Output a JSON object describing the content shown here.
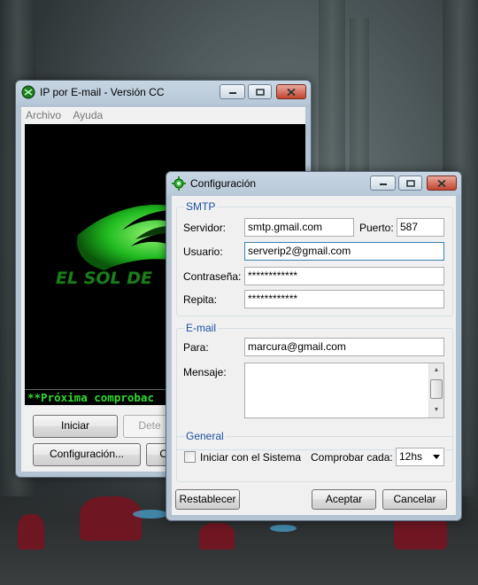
{
  "main_window": {
    "title": "IP por E-mail - Versión CC",
    "menu": [
      "Archivo",
      "Ayuda"
    ],
    "logo_text": "EL SOL DE",
    "status_text": "**Próxima comprobac",
    "buttons": {
      "start": "Iniciar",
      "stop": "Dete",
      "config": "Configuración...",
      "partial": "O"
    }
  },
  "config_dialog": {
    "title": "Configuración",
    "smtp": {
      "group_label": "SMTP",
      "server_label": "Servidor:",
      "server_value": "smtp.gmail.com",
      "port_label": "Puerto:",
      "port_value": "587",
      "user_label": "Usuario:",
      "user_value": "serverip2@gmail.com",
      "password_label": "Contraseña:",
      "password_value": "************",
      "repeat_label": "Repita:",
      "repeat_value": "************"
    },
    "email": {
      "group_label": "E-mail",
      "to_label": "Para:",
      "to_value": "marcura@gmail.com",
      "message_label": "Mensaje:",
      "message_value": ""
    },
    "general": {
      "group_label": "General",
      "startup_label": "Iniciar con el Sistema",
      "startup_checked": false,
      "check_every_label": "Comprobar cada:",
      "check_every_value": "12hs"
    },
    "buttons": {
      "reset": "Restablecer",
      "accept": "Aceptar",
      "cancel": "Cancelar"
    }
  },
  "colors": {
    "group_label": "#1e50a2",
    "status_text": "#2fd92f",
    "logo_green": "#22c522"
  },
  "icons": [
    "app-globe-icon",
    "gear-icon",
    "minimize-icon",
    "maximize-icon",
    "close-icon"
  ]
}
